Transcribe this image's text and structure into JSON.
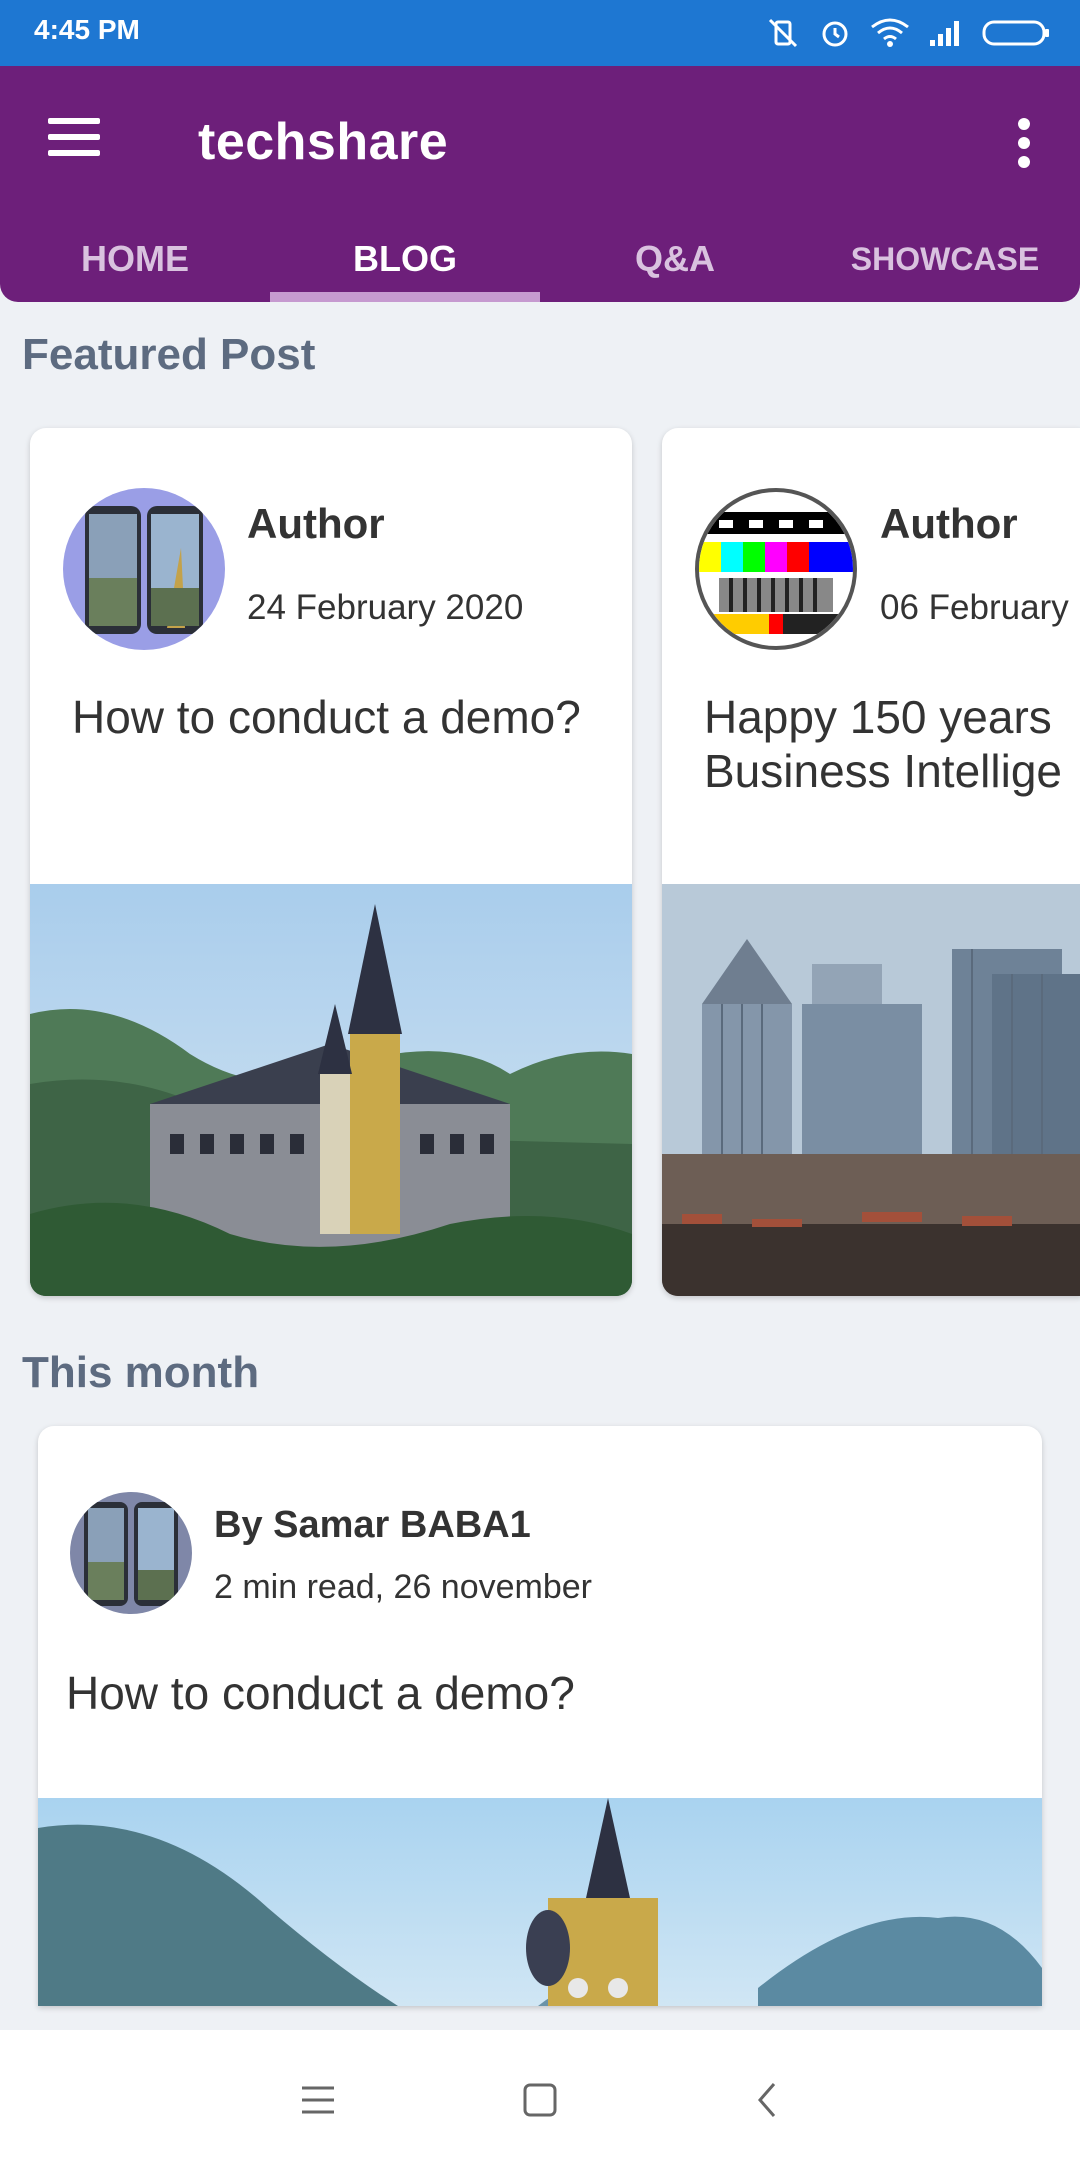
{
  "status_bar": {
    "time": "4:45 PM",
    "icons": [
      "vibrate-off-icon",
      "alarm-icon",
      "wifi-icon",
      "signal-icon",
      "battery-icon"
    ]
  },
  "app_bar": {
    "title": "techshare",
    "menu_icon": "hamburger-menu-icon",
    "more_icon": "more-vertical-icon",
    "tabs": [
      "HOME",
      "BLOG",
      "Q&A",
      "SHOWCASE"
    ],
    "active_tab": "BLOG"
  },
  "featured": {
    "heading": "Featured Post",
    "cards": [
      {
        "author": "Author",
        "date": "24 February 2020",
        "title": "How to conduct a demo?"
      },
      {
        "author": "Author",
        "date": "06 February",
        "title": "Happy 150 years Business Intellige"
      }
    ]
  },
  "this_month": {
    "heading": "This month",
    "post": {
      "author": "By Samar BABA1",
      "meta": "2 min read, 26 november",
      "title": "How to conduct a demo?"
    }
  },
  "nav_bar": {
    "icons": [
      "recents-icon",
      "home-icon",
      "back-icon"
    ]
  },
  "colors": {
    "status_bar": "#1e77d2",
    "app_bar": "#6d1f7a",
    "tab_indicator": "#c69ad0",
    "background": "#eef1f5",
    "section_title": "#5d6b80"
  }
}
